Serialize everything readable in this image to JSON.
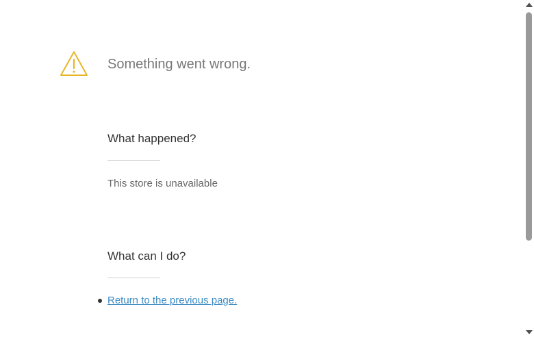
{
  "error": {
    "title": "Something went wrong.",
    "icon": "warning-icon",
    "accent_color": "#e7b628"
  },
  "what_happened": {
    "heading": "What happened?",
    "message": "This store is unavailable"
  },
  "what_can_i_do": {
    "heading": "What can I do?",
    "actions": [
      {
        "label": "Return to the previous page."
      }
    ]
  },
  "colors": {
    "link": "#3b8bc4",
    "title": "#777777",
    "heading": "#333333"
  }
}
